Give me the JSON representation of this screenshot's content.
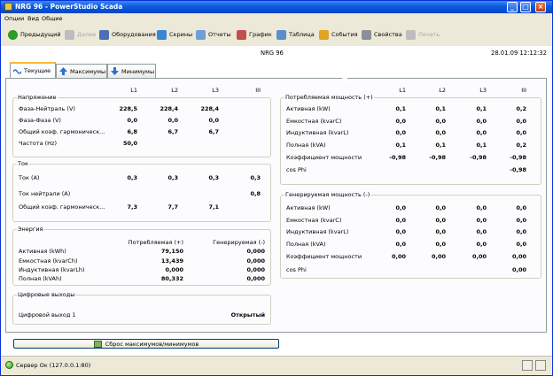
{
  "window": {
    "title": "NRG 96 - PowerStudio Scada"
  },
  "menu": [
    "Опции",
    "Вид",
    "Общие"
  ],
  "toolbar": [
    {
      "label": "Предыдущий",
      "icon": "back-arrow-icon",
      "color": "#2e9b24",
      "enabled": true
    },
    {
      "label": "Далее",
      "icon": "forward-arrow-icon",
      "color": "#bdbdbd",
      "enabled": false
    },
    {
      "label": "Оборудования",
      "icon": "device-icon",
      "color": "#4a6fb5",
      "enabled": true
    },
    {
      "label": "Скрины",
      "icon": "screen-icon",
      "color": "#3a86d6",
      "enabled": true
    },
    {
      "label": "Отчеты",
      "icon": "report-icon",
      "color": "#6f9fd8",
      "enabled": true
    },
    {
      "label": "График",
      "icon": "graph-icon",
      "color": "#c0504d",
      "enabled": true
    },
    {
      "label": "Таблица",
      "icon": "table-icon",
      "color": "#5a8fcf",
      "enabled": true
    },
    {
      "label": "События",
      "icon": "events-icon",
      "color": "#e0a423",
      "enabled": true
    },
    {
      "label": "Свойства",
      "icon": "properties-icon",
      "color": "#8a8f9a",
      "enabled": true
    },
    {
      "label": "Печать",
      "icon": "print-icon",
      "color": "#bdbdbd",
      "enabled": false
    }
  ],
  "device": {
    "name": "NRG 96",
    "datetime": "28.01.09 12:12:32"
  },
  "tabs": [
    {
      "label": "Текущие",
      "icon": "wave-icon",
      "active": true
    },
    {
      "label": "Максимумы",
      "icon": "up-arrow-icon",
      "active": false
    },
    {
      "label": "Минимумы",
      "icon": "down-arrow-icon",
      "active": false
    }
  ],
  "phase_headers": [
    "L1",
    "L2",
    "L3",
    "III"
  ],
  "voltage": {
    "title": "Напряжение",
    "rows": [
      {
        "label": "Фаза-Нейтраль (V)",
        "values": [
          "228,5",
          "228,4",
          "228,4",
          ""
        ]
      },
      {
        "label": "Фаза-Фаза (V)",
        "values": [
          "0,0",
          "0,0",
          "0,0",
          ""
        ]
      },
      {
        "label": "Общий коэф. гармоническ...",
        "values": [
          "6,8",
          "6,7",
          "6,7",
          ""
        ]
      },
      {
        "label": "Частота (Hz)",
        "values": [
          "50,0",
          "",
          "",
          ""
        ]
      }
    ]
  },
  "current": {
    "title": "Ток",
    "rows": [
      {
        "label": "Ток (A)",
        "values": [
          "0,3",
          "0,3",
          "0,3",
          "0,3"
        ]
      },
      {
        "label": "Ток нейтрали (A)",
        "values": [
          "",
          "",
          "",
          "0,8"
        ]
      },
      {
        "label": "Общий коэф. гармоническ...",
        "values": [
          "7,3",
          "7,7",
          "7,1",
          ""
        ]
      }
    ]
  },
  "energy": {
    "title": "Энергия",
    "col_consumed": "Потребляемая (+)",
    "col_generated": "Генерируемая (-)",
    "rows": [
      {
        "label": "Активная (kWh)",
        "consumed": "79,150",
        "generated": "0,000"
      },
      {
        "label": "Емкостная (kvarCh)",
        "consumed": "13,439",
        "generated": "0,000"
      },
      {
        "label": "Индуктивная (kvarLh)",
        "consumed": "0,000",
        "generated": "0,000"
      },
      {
        "label": "Полная (kVAh)",
        "consumed": "80,332",
        "generated": "0,000"
      }
    ]
  },
  "digital_outputs": {
    "title": "Цифровые выходы",
    "rows": [
      {
        "label": "Цифровой выход 1",
        "value": "Открытый"
      }
    ]
  },
  "power_consumed": {
    "title": "Потребляемая мощность (+)",
    "rows": [
      {
        "label": "Активная (kW)",
        "values": [
          "0,1",
          "0,1",
          "0,1",
          "0,2"
        ]
      },
      {
        "label": "Емкостная (kvarC)",
        "values": [
          "0,0",
          "0,0",
          "0,0",
          "0,0"
        ]
      },
      {
        "label": "Индуктивная (kvarL)",
        "values": [
          "0,0",
          "0,0",
          "0,0",
          "0,0"
        ]
      },
      {
        "label": "Полная (kVA)",
        "values": [
          "0,1",
          "0,1",
          "0,1",
          "0,2"
        ]
      },
      {
        "label": "Коэффициент мощности",
        "values": [
          "-0,98",
          "-0,98",
          "-0,98",
          "-0,98"
        ]
      },
      {
        "label": "cos Phi",
        "values": [
          "",
          "",
          "",
          "-0,98"
        ]
      }
    ]
  },
  "power_generated": {
    "title": "Генерируемая мощность (-)",
    "rows": [
      {
        "label": "Активная (kW)",
        "values": [
          "0,0",
          "0,0",
          "0,0",
          "0,0"
        ]
      },
      {
        "label": "Емкостная (kvarC)",
        "values": [
          "0,0",
          "0,0",
          "0,0",
          "0,0"
        ]
      },
      {
        "label": "Индуктивная (kvarL)",
        "values": [
          "0,0",
          "0,0",
          "0,0",
          "0,0"
        ]
      },
      {
        "label": "Полная (kVA)",
        "values": [
          "0,0",
          "0,0",
          "0,0",
          "0,0"
        ]
      },
      {
        "label": "Коэффициент мощности",
        "values": [
          "0,00",
          "0,00",
          "0,00",
          "0,00"
        ]
      },
      {
        "label": "cos Phi",
        "values": [
          "",
          "",
          "",
          "0,00"
        ]
      }
    ]
  },
  "reset_button": "Сброс максимумов/минимумов",
  "status": {
    "text": "Сервер Ок (127.0.0.1:80)"
  }
}
